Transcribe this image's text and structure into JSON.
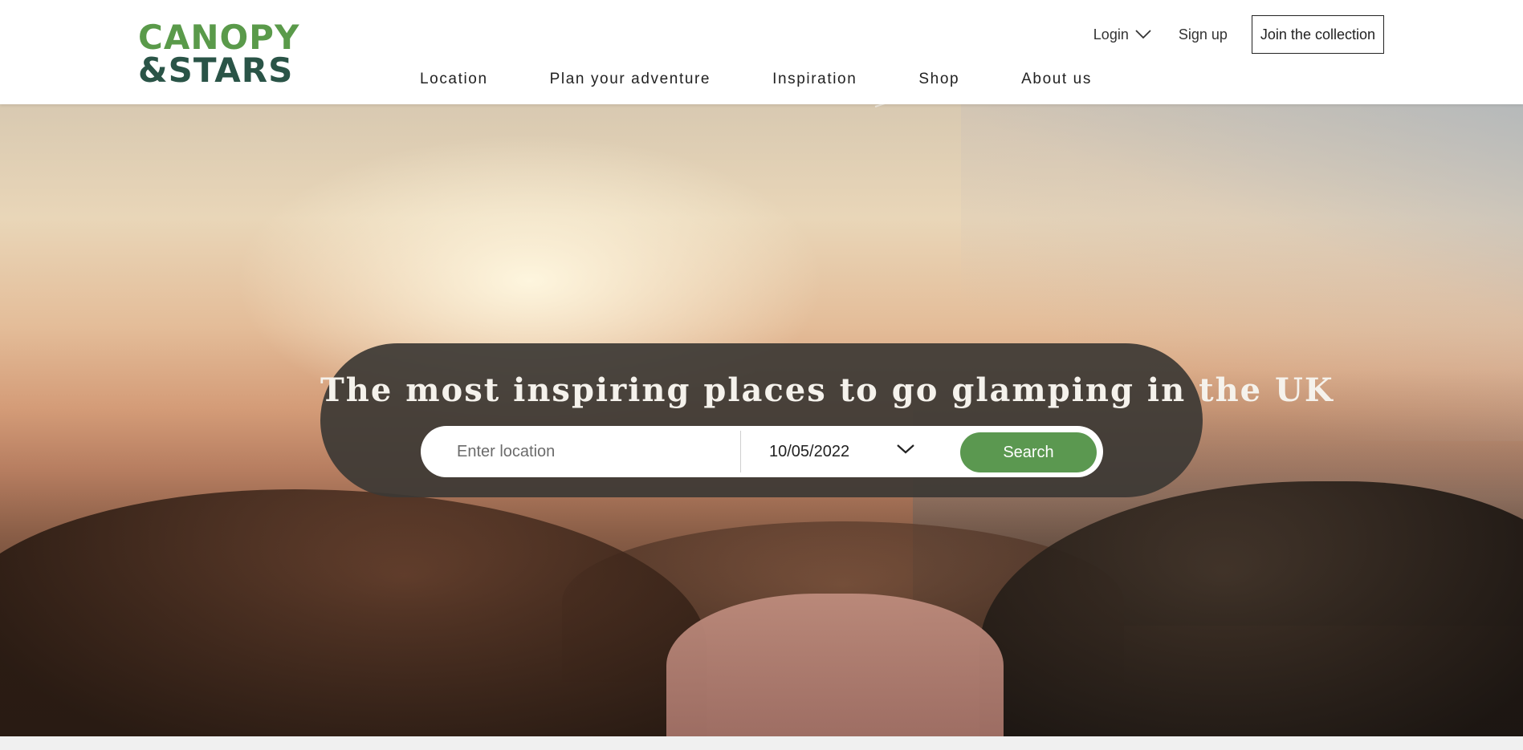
{
  "brand": {
    "logo_line1": "CANOPY",
    "logo_line2": "&STARS",
    "primary_color": "#5a9a4a",
    "secondary_color": "#2a5447"
  },
  "header": {
    "login_label": "Login",
    "signup_label": "Sign up",
    "join_label": "Join the collection"
  },
  "nav": {
    "items": [
      {
        "label": "Location"
      },
      {
        "label": "Plan your adventure"
      },
      {
        "label": "Inspiration"
      },
      {
        "label": "Shop"
      },
      {
        "label": "About us"
      }
    ]
  },
  "hero": {
    "title": "The most inspiring places to go glamping in the UK",
    "search": {
      "location_placeholder": "Enter location",
      "location_value": "",
      "date_value": "10/05/2022",
      "button_label": "Search",
      "button_color": "#5b9850"
    }
  },
  "icons": {
    "login_dropdown": "chevron-down-icon",
    "date_dropdown": "chevron-down-icon"
  }
}
